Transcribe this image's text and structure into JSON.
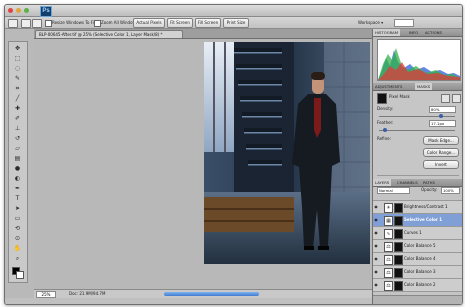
{
  "app": {
    "logo": "Ps"
  },
  "options_bar": {
    "checkbox1_label": "Resize Windows To Fit",
    "checkbox2_label": "Zoom All Windows",
    "buttons": [
      "Actual Pixels",
      "Fit Screen",
      "Fill Screen",
      "Print Size"
    ],
    "workspace_label": "Workspace ▾"
  },
  "document": {
    "tab_title": "BLP-00645-After.tif @ 25% (Selective Color 1, Layer Mask/8) *",
    "zoom": "25%",
    "info": "Doc: 21.9M/94.7M"
  },
  "panels": {
    "top_tabs": [
      "HISTOGRAM",
      "INFO",
      "ACTIONS"
    ],
    "adj_tabs": [
      "ADJUSTMENTS",
      "MASKS"
    ],
    "masks": {
      "mode_label": "Pixel Mask",
      "density_label": "Density:",
      "density_value": "80%",
      "feather_label": "Feather:",
      "feather_value": "17.1px",
      "refine_label": "Refine:",
      "mask_edge": "Mask Edge...",
      "color_range": "Color Range...",
      "invert": "Invert"
    },
    "layers_tabs": [
      "LAYERS",
      "CHANNELS",
      "PATHS"
    ],
    "blend_mode": "Normal",
    "opacity_label": "Opacity:",
    "opacity_value": "100%",
    "layers": [
      {
        "name": "Brightness/Contrast 1",
        "selected": false
      },
      {
        "name": "Selective Color 1",
        "selected": true
      },
      {
        "name": "Curves 1",
        "selected": false
      },
      {
        "name": "Color Balance 5",
        "selected": false
      },
      {
        "name": "Color Balance 4",
        "selected": false
      },
      {
        "name": "Color Balance 3",
        "selected": false
      },
      {
        "name": "Color Balance 2",
        "selected": false
      }
    ]
  },
  "tools": [
    "move-icon",
    "marquee-icon",
    "lasso-icon",
    "quick-select-icon",
    "crop-icon",
    "eyedropper-icon",
    "healing-icon",
    "brush-icon",
    "clone-stamp-icon",
    "history-brush-icon",
    "eraser-icon",
    "gradient-icon",
    "blur-icon",
    "dodge-icon",
    "pen-icon",
    "type-icon",
    "path-select-icon",
    "shape-icon",
    "3d-rotate-icon",
    "3d-orbit-icon",
    "hand-icon",
    "zoom-icon"
  ]
}
